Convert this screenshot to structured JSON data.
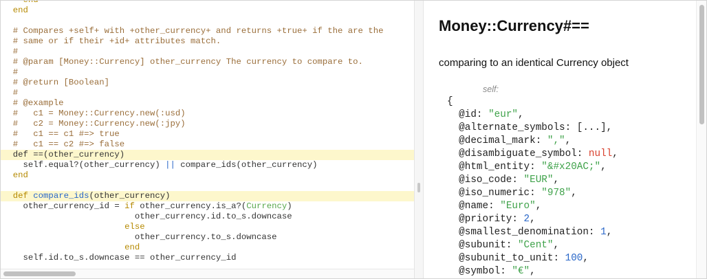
{
  "code": {
    "lines": [
      {
        "text": "    end",
        "hl": false
      },
      {
        "text": "  end",
        "hl": false
      },
      {
        "text": "",
        "hl": false
      },
      {
        "text": "  # Compares +self+ with +other_currency+ and returns +true+ if the are the",
        "hl": false
      },
      {
        "text": "  # same or if their +id+ attributes match.",
        "hl": false
      },
      {
        "text": "  #",
        "hl": false
      },
      {
        "text": "  # @param [Money::Currency] other_currency The currency to compare to.",
        "hl": false
      },
      {
        "text": "  #",
        "hl": false
      },
      {
        "text": "  # @return [Boolean]",
        "hl": false
      },
      {
        "text": "  #",
        "hl": false
      },
      {
        "text": "  # @example",
        "hl": false
      },
      {
        "text": "  #   c1 = Money::Currency.new(:usd)",
        "hl": false
      },
      {
        "text": "  #   c2 = Money::Currency.new(:jpy)",
        "hl": false
      },
      {
        "text": "  #   c1 == c1 #=> true",
        "hl": false
      },
      {
        "text": "  #   c1 == c2 #=> false",
        "hl": false
      },
      {
        "text": "  def ==(other_currency)",
        "hl": true
      },
      {
        "text": "    self.equal?(other_currency) || compare_ids(other_currency)",
        "hl": false
      },
      {
        "text": "  end",
        "hl": false
      },
      {
        "text": "",
        "hl": false
      },
      {
        "text": "  def compare_ids(other_currency)",
        "hl": true
      },
      {
        "text": "    other_currency_id = if other_currency.is_a?(Currency)",
        "hl": false
      },
      {
        "text": "                          other_currency.id.to_s.downcase",
        "hl": false
      },
      {
        "text": "                        else",
        "hl": false
      },
      {
        "text": "                          other_currency.to_s.downcase",
        "hl": false
      },
      {
        "text": "                        end",
        "hl": false
      },
      {
        "text": "    self.id.to_s.downcase == other_currency_id",
        "hl": false
      }
    ]
  },
  "doc": {
    "title": "Money::Currency#==",
    "description": "comparing to an identical Currency object",
    "self_label": "self:",
    "open_brace": "{",
    "attributes": [
      {
        "key": "@id: ",
        "value": "\"eur\"",
        "type": "string"
      },
      {
        "key": "@alternate_symbols: ",
        "value": "[...]",
        "type": "plain"
      },
      {
        "key": "@decimal_mark: ",
        "value": "\",\"",
        "type": "string"
      },
      {
        "key": "@disambiguate_symbol: ",
        "value": "null",
        "type": "null"
      },
      {
        "key": "@html_entity: ",
        "value": "\"&#x20AC;\"",
        "type": "string"
      },
      {
        "key": "@iso_code: ",
        "value": "\"EUR\"",
        "type": "string"
      },
      {
        "key": "@iso_numeric: ",
        "value": "\"978\"",
        "type": "string"
      },
      {
        "key": "@name: ",
        "value": "\"Euro\"",
        "type": "string"
      },
      {
        "key": "@priority: ",
        "value": "2",
        "type": "number"
      },
      {
        "key": "@smallest_denomination: ",
        "value": "1",
        "type": "number"
      },
      {
        "key": "@subunit: ",
        "value": "\"Cent\"",
        "type": "string"
      },
      {
        "key": "@subunit_to_unit: ",
        "value": "100",
        "type": "number"
      },
      {
        "key": "@symbol: ",
        "value": "\"€\"",
        "type": "string"
      }
    ]
  },
  "colors": {
    "comment": "#9a6e3a",
    "keyword": "#b58900",
    "function": "#2866c8",
    "class": "#57a64a",
    "string": "#3fa24a",
    "number": "#2866c8",
    "null": "#d9412e",
    "highlight": "#fdf7cc"
  }
}
